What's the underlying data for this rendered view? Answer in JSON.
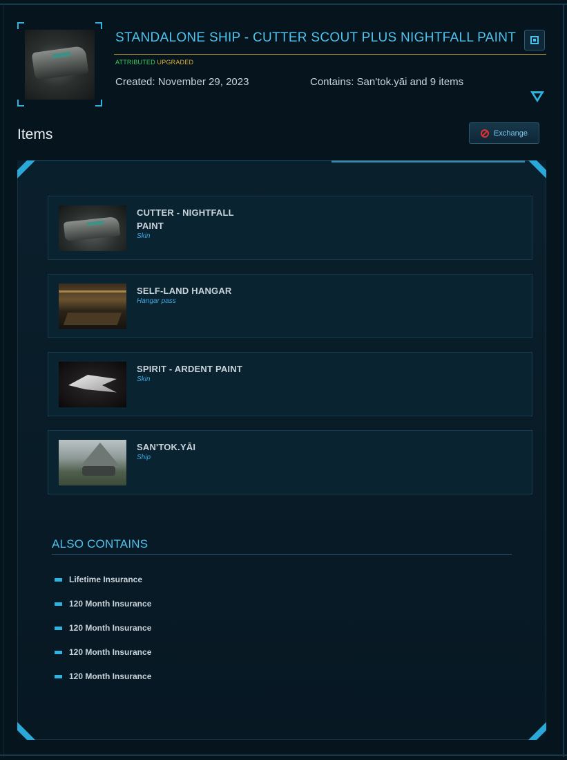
{
  "header": {
    "title": "STANDALONE SHIP - CUTTER SCOUT PLUS NIGHTFALL PAINT",
    "tag_attributed": "ATTRIBUTED",
    "tag_upgraded": "UPGRADED",
    "created": "Created: November 29, 2023",
    "contains": "Contains: San'tok.yāi and 9 items"
  },
  "items_section": {
    "heading": "Items",
    "exchange_label": "Exchange"
  },
  "items": [
    {
      "name": "CUTTER - NIGHTFALL PAINT",
      "type": "Skin"
    },
    {
      "name": "SELF-LAND HANGAR",
      "type": "Hangar pass"
    },
    {
      "name": "SPIRIT - ARDENT PAINT",
      "type": "Skin"
    },
    {
      "name": "SAN'TOK.YĀI",
      "type": "Ship"
    }
  ],
  "also_contains": {
    "heading": "ALSO CONTAINS",
    "items": [
      "Lifetime Insurance",
      "120 Month Insurance",
      "120 Month Insurance",
      "120 Month Insurance",
      "120 Month Insurance"
    ]
  },
  "colors": {
    "accent": "#4fc3ee",
    "background": "#06141d",
    "attributed": "#3fcf5a",
    "upgraded": "#e0b030",
    "exchange_icon": "#e53030"
  },
  "icons": [
    "chip-icon",
    "expand-triangle-icon",
    "no-entry-icon",
    "bullet-icon"
  ]
}
